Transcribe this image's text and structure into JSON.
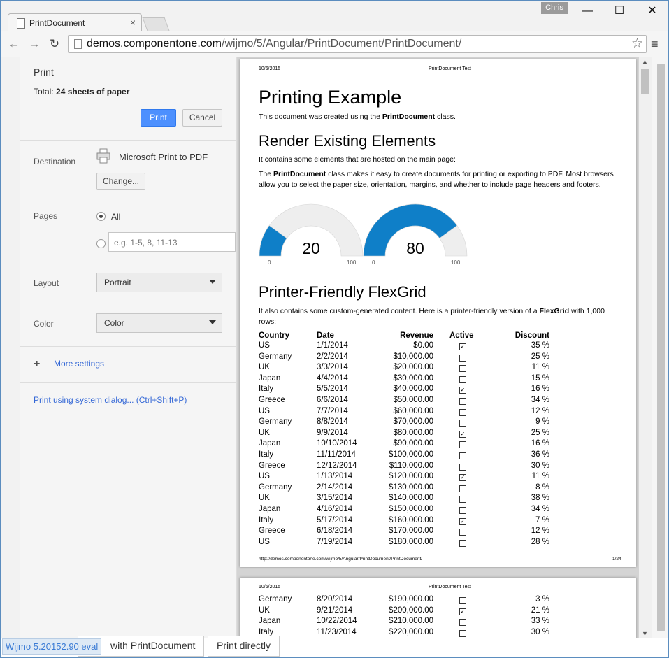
{
  "browser": {
    "tab_title": "PrintDocument",
    "tab_close": "×",
    "user": "Chris",
    "win_minimize": "—",
    "win_maximize": "☐",
    "win_close": "✕",
    "back": "←",
    "forward": "→",
    "reload": "↻",
    "url_host": "demos.componentone.com",
    "url_path": "/wijmo/5/Angular/PrintDocument/PrintDocument/",
    "star": "☆",
    "menu": "≡"
  },
  "print_panel": {
    "heading": "Print",
    "total_prefix": "Total: ",
    "total_value": "24 sheets of paper",
    "print_label": "Print",
    "cancel_label": "Cancel",
    "destination_label": "Destination",
    "destination_value": "Microsoft Print to PDF",
    "change_label": "Change...",
    "pages_label": "Pages",
    "pages_all": "All",
    "pages_placeholder": "e.g. 1-5, 8, 11-13",
    "layout_label": "Layout",
    "layout_value": "Portrait",
    "color_label": "Color",
    "color_value": "Color",
    "more_plus": "+",
    "more_settings": "More settings",
    "system_dialog": "Print using system dialog... (Ctrl+Shift+P)"
  },
  "document": {
    "header_date": "10/6/2015",
    "header_title": "PrintDocument Test",
    "h1": "Printing Example",
    "intro_pre": "This document was created using the ",
    "intro_bold": "PrintDocument",
    "intro_post": " class.",
    "h2_render": "Render Existing Elements",
    "render_p1": "It contains some elements that are hosted on the main page:",
    "render_p2_pre": "The ",
    "render_p2_bold": "PrintDocument",
    "render_p2_post": " class makes it easy to create documents for printing or exporting to PDF. Most browsers allow you to select the paper size, orientation, margins, and whether to include page headers and footers.",
    "gauges": [
      {
        "value": 20,
        "min": "0",
        "max": "100",
        "label": "20"
      },
      {
        "value": 80,
        "min": "0",
        "max": "100",
        "label": "80"
      }
    ],
    "h2_grid": "Printer-Friendly FlexGrid",
    "grid_p_pre": "It also contains some custom-generated content. Here is a printer-friendly version of a ",
    "grid_p_bold": "FlexGrid",
    "grid_p_post": " with 1,000 rows:",
    "columns": [
      "Country",
      "Date",
      "Revenue",
      "Active",
      "Discount"
    ],
    "rows": [
      [
        "US",
        "1/1/2014",
        "$0.00",
        true,
        "35 %"
      ],
      [
        "Germany",
        "2/2/2014",
        "$10,000.00",
        false,
        "25 %"
      ],
      [
        "UK",
        "3/3/2014",
        "$20,000.00",
        false,
        "11 %"
      ],
      [
        "Japan",
        "4/4/2014",
        "$30,000.00",
        false,
        "15 %"
      ],
      [
        "Italy",
        "5/5/2014",
        "$40,000.00",
        true,
        "16 %"
      ],
      [
        "Greece",
        "6/6/2014",
        "$50,000.00",
        false,
        "34 %"
      ],
      [
        "US",
        "7/7/2014",
        "$60,000.00",
        false,
        "12 %"
      ],
      [
        "Germany",
        "8/8/2014",
        "$70,000.00",
        false,
        "9 %"
      ],
      [
        "UK",
        "9/9/2014",
        "$80,000.00",
        true,
        "25 %"
      ],
      [
        "Japan",
        "10/10/2014",
        "$90,000.00",
        false,
        "16 %"
      ],
      [
        "Italy",
        "11/11/2014",
        "$100,000.00",
        false,
        "36 %"
      ],
      [
        "Greece",
        "12/12/2014",
        "$110,000.00",
        false,
        "30 %"
      ],
      [
        "US",
        "1/13/2014",
        "$120,000.00",
        true,
        "11 %"
      ],
      [
        "Germany",
        "2/14/2014",
        "$130,000.00",
        false,
        "8 %"
      ],
      [
        "UK",
        "3/15/2014",
        "$140,000.00",
        false,
        "38 %"
      ],
      [
        "Japan",
        "4/16/2014",
        "$150,000.00",
        false,
        "34 %"
      ],
      [
        "Italy",
        "5/17/2014",
        "$160,000.00",
        true,
        "7 %"
      ],
      [
        "Greece",
        "6/18/2014",
        "$170,000.00",
        false,
        "12 %"
      ],
      [
        "US",
        "7/19/2014",
        "$180,000.00",
        false,
        "28 %"
      ]
    ],
    "footer_url": "http://demos.componentone.com/wijmo/5/Angular/PrintDocument/PrintDocument/",
    "footer_page": "1/24",
    "page2_rows": [
      [
        "Germany",
        "8/20/2014",
        "$190,000.00",
        false,
        "3 %"
      ],
      [
        "UK",
        "9/21/2014",
        "$200,000.00",
        true,
        "21 %"
      ],
      [
        "Japan",
        "10/22/2014",
        "$210,000.00",
        false,
        "33 %"
      ],
      [
        "Italy",
        "11/23/2014",
        "$220,000.00",
        false,
        "30 %"
      ]
    ]
  },
  "status": {
    "text": "Wijmo 5.20152.90 eval",
    "button1": "with PrintDocument",
    "button2": "Print directly"
  },
  "colors": {
    "gauge_fill": "#0f7fc8",
    "gauge_track": "#eeeeee",
    "print_button": "#4d90fe",
    "link": "#3367d6"
  }
}
